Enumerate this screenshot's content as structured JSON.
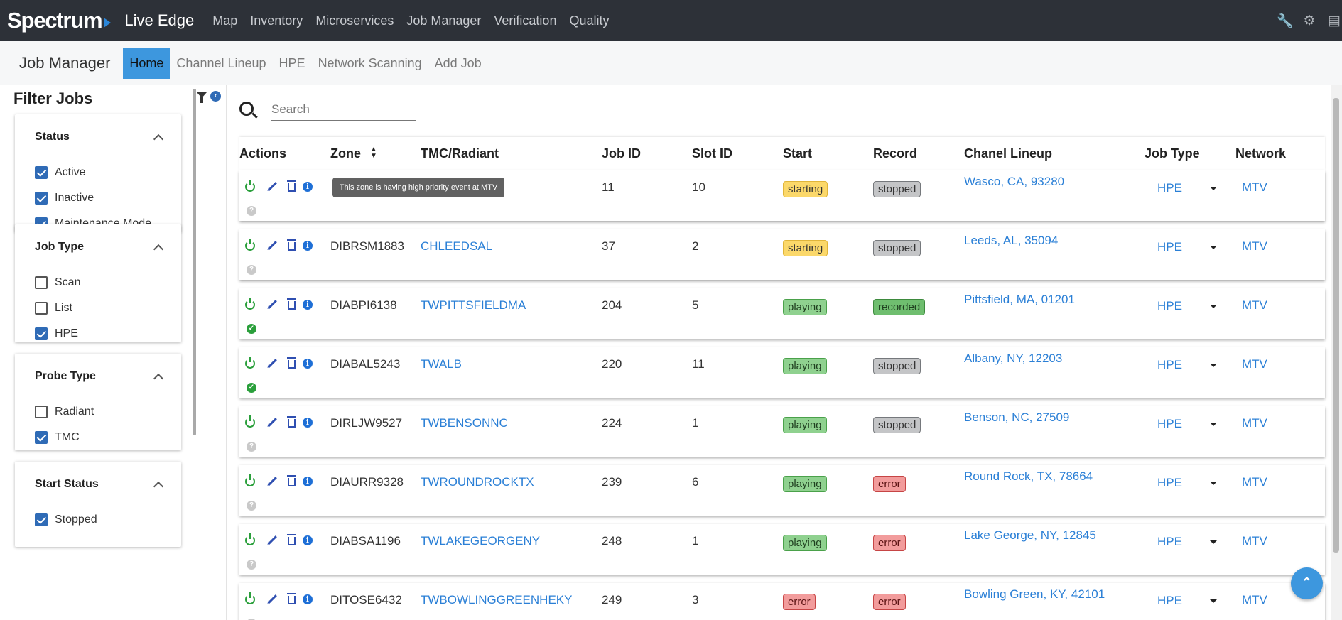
{
  "topnav": {
    "brand": "Spectrum",
    "product": "Live Edge",
    "links": [
      "Map",
      "Inventory",
      "Microservices",
      "Job Manager",
      "Verification",
      "Quality"
    ],
    "icons": [
      "wrench-icon",
      "gear-icon",
      "book-icon"
    ]
  },
  "subnav": {
    "title": "Job Manager",
    "tabs": [
      "Home",
      "Channel Lineup",
      "HPE",
      "Network Scanning",
      "Add Job"
    ],
    "active_tab": "Home"
  },
  "sidebar": {
    "title": "Filter Jobs",
    "panels": [
      {
        "title": "Status",
        "options": [
          {
            "label": "Active",
            "checked": true
          },
          {
            "label": "Inactive",
            "checked": true
          },
          {
            "label": "Maintenance Mode",
            "checked": true
          }
        ]
      },
      {
        "title": "Job Type",
        "options": [
          {
            "label": "Scan",
            "checked": false
          },
          {
            "label": "List",
            "checked": false
          },
          {
            "label": "HPE",
            "checked": true
          }
        ]
      },
      {
        "title": "Probe Type",
        "options": [
          {
            "label": "Radiant",
            "checked": false
          },
          {
            "label": "TMC",
            "checked": true
          }
        ]
      },
      {
        "title": "Start Status",
        "options": [
          {
            "label": "Stopped",
            "checked": true
          }
        ]
      }
    ]
  },
  "search": {
    "placeholder": "Search"
  },
  "table": {
    "headers": [
      "Actions",
      "Zone",
      "TMC/Radiant",
      "Job ID",
      "Slot ID",
      "Start",
      "Record",
      "Chanel Lineup",
      "Job Type",
      "Network"
    ],
    "tooltip": "This zone is having high priority event at MTV",
    "rows": [
      {
        "zone": "",
        "tmc": "",
        "job_id": "11",
        "slot_id": "10",
        "start": "starting",
        "record": "stopped",
        "lineup": "Wasco, CA, 93280",
        "job_type": "HPE",
        "network": "MTV",
        "health": "q"
      },
      {
        "zone": "DIBRSM1883",
        "tmc": "CHLEEDSAL",
        "job_id": "37",
        "slot_id": "2",
        "start": "starting",
        "record": "stopped",
        "lineup": "Leeds, AL, 35094",
        "job_type": "HPE",
        "network": "MTV",
        "health": "q"
      },
      {
        "zone": "DIABPI6138",
        "tmc": "TWPITTSFIELDMA",
        "job_id": "204",
        "slot_id": "5",
        "start": "playing",
        "record": "recorded",
        "lineup": "Pittsfield, MA, 01201",
        "job_type": "HPE",
        "network": "MTV",
        "health": "ok"
      },
      {
        "zone": "DIABAL5243",
        "tmc": "TWALB",
        "job_id": "220",
        "slot_id": "11",
        "start": "playing",
        "record": "stopped",
        "lineup": "Albany, NY, 12203",
        "job_type": "HPE",
        "network": "MTV",
        "health": "ok"
      },
      {
        "zone": "DIRLJW9527",
        "tmc": "TWBENSONNC",
        "job_id": "224",
        "slot_id": "1",
        "start": "playing",
        "record": "stopped",
        "lineup": "Benson, NC, 27509",
        "job_type": "HPE",
        "network": "MTV",
        "health": "q"
      },
      {
        "zone": "DIAURR9328",
        "tmc": "TWROUNDROCKTX",
        "job_id": "239",
        "slot_id": "6",
        "start": "playing",
        "record": "error",
        "lineup": "Round Rock, TX, 78664",
        "job_type": "HPE",
        "network": "MTV",
        "health": "q"
      },
      {
        "zone": "DIABSA1196",
        "tmc": "TWLAKEGEORGENY",
        "job_id": "248",
        "slot_id": "1",
        "start": "playing",
        "record": "error",
        "lineup": "Lake George, NY, 12845",
        "job_type": "HPE",
        "network": "MTV",
        "health": "q"
      },
      {
        "zone": "DITOSE6432",
        "tmc": "TWBOWLINGGREENHEKY",
        "job_id": "249",
        "slot_id": "3",
        "start": "error",
        "record": "error",
        "lineup": "Bowling Green, KY, 42101",
        "job_type": "HPE",
        "network": "MTV",
        "health": "q"
      }
    ]
  }
}
